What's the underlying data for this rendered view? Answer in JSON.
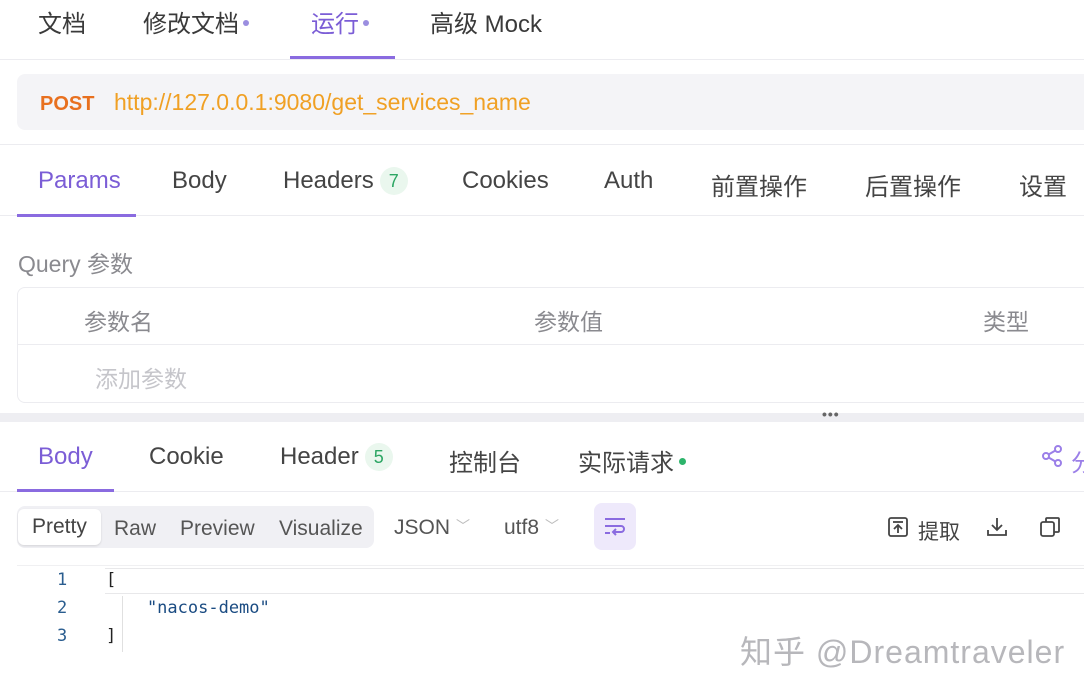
{
  "top_tabs": [
    {
      "label": "文档",
      "dot": false
    },
    {
      "label": "修改文档",
      "dot": true
    },
    {
      "label": "运行",
      "dot": true,
      "active": true
    },
    {
      "label": "高级 Mock",
      "dot": false
    }
  ],
  "request": {
    "method": "POST",
    "url": "http://127.0.0.1:9080/get_services_name"
  },
  "request_tabs": {
    "params": "Params",
    "body": "Body",
    "headers": "Headers",
    "headers_count": "7",
    "cookies": "Cookies",
    "auth": "Auth",
    "pre_ops": "前置操作",
    "post_ops": "后置操作",
    "settings": "设置"
  },
  "query": {
    "label": "Query 参数",
    "columns": [
      "参数名",
      "参数值",
      "类型"
    ],
    "add_placeholder": "添加参数"
  },
  "response_tabs": {
    "body": "Body",
    "cookie": "Cookie",
    "header": "Header",
    "header_count": "5",
    "console": "控制台",
    "actual_request": "实际请求",
    "share": "分"
  },
  "toolbar": {
    "views": [
      "Pretty",
      "Raw",
      "Preview",
      "Visualize"
    ],
    "selected_view": "Pretty",
    "format": "JSON",
    "encoding": "utf8",
    "extract": "提取"
  },
  "code": {
    "line_numbers": [
      "1",
      "2",
      "3"
    ],
    "lines": [
      "[",
      "    \"nacos-demo\"",
      "]"
    ]
  },
  "watermark": "知乎 @Dreamtraveler",
  "colors": {
    "accent": "#7b5dd6",
    "method": "#e8701f",
    "url": "#f0a024",
    "success_dot": "#2db46b"
  }
}
